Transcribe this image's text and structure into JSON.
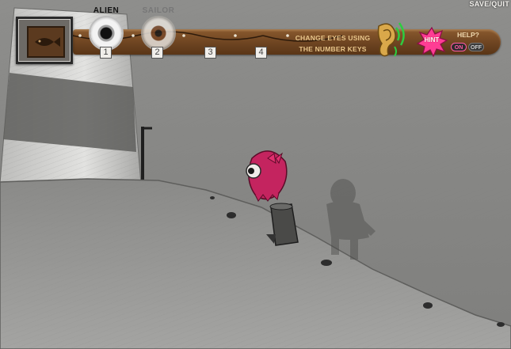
{
  "hud": {
    "save_quit": "SAVE/QUIT",
    "eyes": [
      {
        "label": "ALIEN",
        "number": "1"
      },
      {
        "label": "SAILOR",
        "number": "2"
      },
      {
        "label": "",
        "number": "3"
      },
      {
        "label": "",
        "number": "4"
      }
    ],
    "instructions": [
      "CHANGE EYES USING",
      "THE NUMBER KEYS"
    ],
    "hint_label": "HINT",
    "help_label": "HELP?",
    "help_on": "ON",
    "help_off": "OFF"
  },
  "icons": {
    "portrait": "fish-emblem-icon",
    "ear": "ear-sound-icon",
    "hint": "hint-splat-icon"
  },
  "colors": {
    "hud_wood": "#6b4220",
    "instruction_text": "#e8c58a",
    "character_pink": "#c4245f",
    "hint_pink": "#ff3d94",
    "ear_green": "#2ecc40"
  }
}
